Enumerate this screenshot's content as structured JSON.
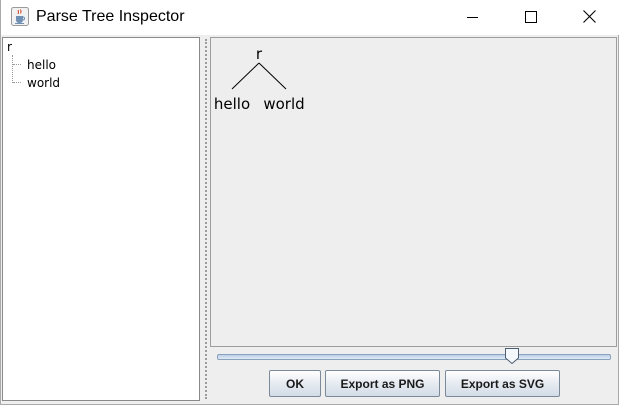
{
  "window": {
    "title": "Parse Tree Inspector",
    "icon": "java-cup-icon"
  },
  "title_buttons": {
    "minimize": "minimize-icon",
    "maximize": "maximize-icon",
    "close": "close-icon"
  },
  "tree_view": {
    "root": "r",
    "children": [
      "hello",
      "world"
    ]
  },
  "parse_tree": {
    "root": "r",
    "children": [
      "hello",
      "world"
    ]
  },
  "zoom_slider": {
    "value_fraction": 0.76
  },
  "buttons": {
    "ok": "OK",
    "export_png": "Export as PNG",
    "export_svg": "Export as SVG"
  },
  "colors": {
    "panel_background": "#eeeeee",
    "tree_background": "#ffffff",
    "button_border": "#7a8a99",
    "slider_track": "#bcd0e6"
  }
}
